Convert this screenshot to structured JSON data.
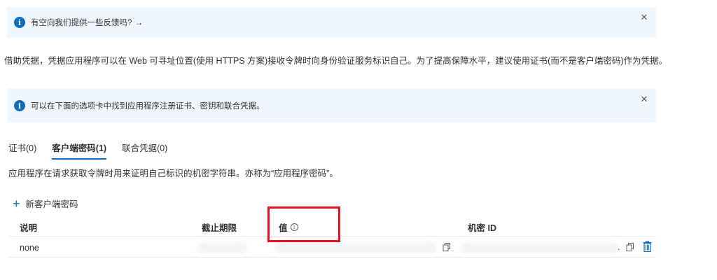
{
  "banners": {
    "feedback": {
      "text": "有空向我们提供一些反馈吗?",
      "arrow": "→"
    },
    "info": {
      "text": "可以在下面的选项卡中找到应用程序注册证书、密钥和联合凭据。"
    }
  },
  "description": "借助凭据，凭据应用程序可以在 Web 可寻址位置(使用 HTTPS 方案)接收令牌时向身份验证服务标识自己。为了提高保障水平，建议使用证书(而不是客户端密码)作为凭据。",
  "tabs": [
    {
      "label": "证书(0)"
    },
    {
      "label": "客户端密码(1)"
    },
    {
      "label": "联合凭据(0)"
    }
  ],
  "subDescription": "应用程序在请求获取令牌时用来证明自己标识的机密字符串。亦称为“应用程序密码”。",
  "newSecret": {
    "label": "新客户端密码"
  },
  "table": {
    "headers": {
      "description": "说明",
      "expires": "截止期限",
      "value": "值",
      "secretId": "机密 ID"
    },
    "rows": [
      {
        "description": "none",
        "idSuffix": "."
      }
    ]
  },
  "colors": {
    "accent": "#0f6cbd",
    "bannerBg": "#eff6fc",
    "highlight": "#e81123"
  },
  "icons": {
    "info": "info-icon",
    "close": "close-icon",
    "plus": "plus-icon",
    "copy": "copy-icon",
    "trash": "trash-icon"
  }
}
